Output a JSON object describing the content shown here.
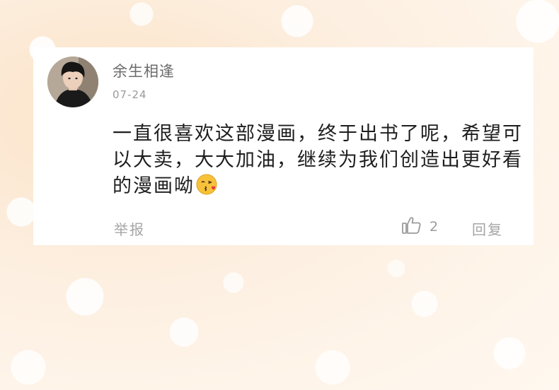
{
  "comment": {
    "username": "余生相逢",
    "date": "07-24",
    "content": "一直很喜欢这部漫画，终于出书了呢，希望可以大卖，大大加油，继续为我们创造出更好看的漫画呦",
    "emoji": "kissing-face-with-heart-emoji",
    "report_label": "举报",
    "like_icon": "thumbs-up-icon",
    "like_count": "2",
    "reply_label": "回复"
  },
  "colors": {
    "card_background": "#ffffff",
    "username": "#6b6b6b",
    "meta": "#9a9a9a",
    "body_text": "#1e1e1e",
    "background_tint": "#fbe3c8"
  }
}
